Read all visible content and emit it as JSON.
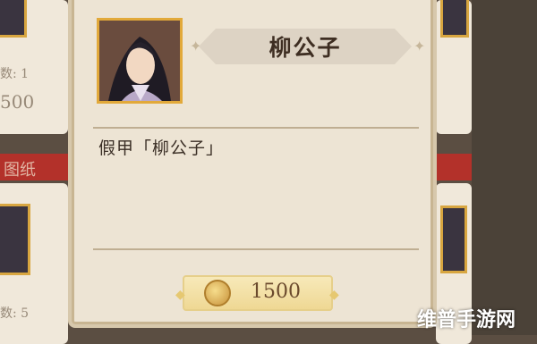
{
  "background": {
    "left_count_top": "数: 1",
    "left_price_top": "500",
    "left_ribbon_text": "图纸",
    "left_count_bottom": "数: 5"
  },
  "item": {
    "name": "柳公子",
    "description": "假甲「柳公子」",
    "price": "1500",
    "currency_icon": "coin-icon"
  },
  "watermark": "维普手游网",
  "colors": {
    "modal_bg": "#ede4d4",
    "portrait_border": "#e2a93a",
    "ribbon_red": "#b3312a",
    "price_pill": "#f2dfa2"
  }
}
